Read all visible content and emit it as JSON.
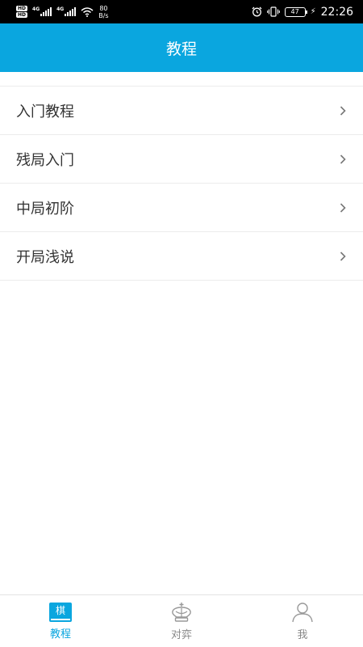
{
  "status_bar": {
    "hd1": "HD",
    "hd2": "HD",
    "net1": "4G",
    "net2": "4G",
    "speed_value": "80",
    "speed_unit": "B/s",
    "battery": "47",
    "time": "22:26"
  },
  "header": {
    "title": "教程"
  },
  "menu": [
    {
      "label": "入门教程"
    },
    {
      "label": "残局入门"
    },
    {
      "label": "中局初阶"
    },
    {
      "label": "开局浅说"
    }
  ],
  "bottom_nav": [
    {
      "label": "教程",
      "icon": "book-icon",
      "glyph": "棋",
      "active": true
    },
    {
      "label": "对弈",
      "icon": "chess-king-icon",
      "active": false
    },
    {
      "label": "我",
      "icon": "user-icon",
      "active": false
    }
  ],
  "colors": {
    "accent": "#0aa6df",
    "status_bar_bg": "#000000",
    "text": "#333333",
    "inactive": "#888888"
  }
}
